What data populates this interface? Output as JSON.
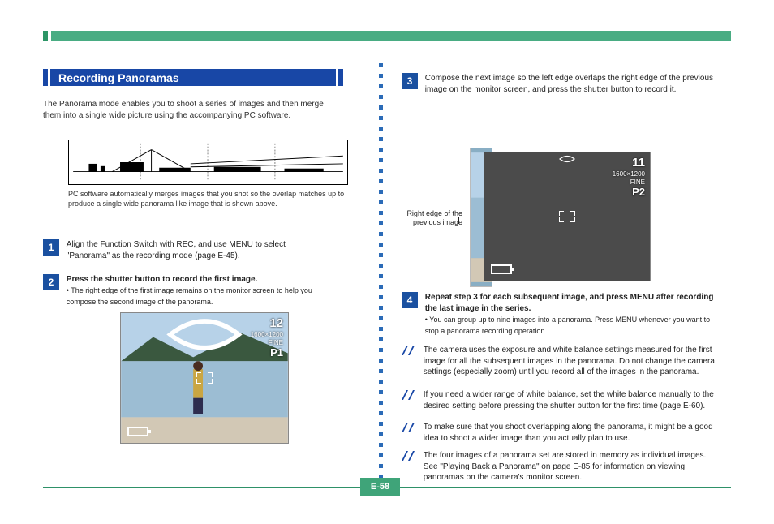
{
  "header": {
    "spacer": " "
  },
  "section": {
    "title": "Recording Panoramas",
    "intro": "The Panorama mode enables you to shoot a series of images and then merge them into a single wide picture using the accompanying PC software."
  },
  "pano_illustration": {
    "caption": "PC software automatically merges images that you shot so the overlap matches up to produce a single wide panorama like image that is shown above."
  },
  "steps": [
    {
      "num": "1",
      "html": "Align the Function Switch with REC, and use MENU to select \"Panorama\" as the recording mode (page E-45)."
    },
    {
      "num": "2",
      "html": "Press the shutter button to record the first image.",
      "note": "The right edge of the first image remains on the monitor screen to help you compose the second image of the panorama."
    },
    {
      "num": "3",
      "html": "Compose the next image so the left edge overlaps the right edge of the previous image on the monitor screen, and press the shutter button to record it."
    },
    {
      "num": "4",
      "html": "Repeat step 3 for each subsequent image, and press MENU after recording the last image in the series.",
      "sub": "You can group up to nine images into a panorama. Press MENU whenever you want to stop a panorama recording operation."
    }
  ],
  "preview1": {
    "count": "12",
    "res": "1600×1200",
    "quality": "FINE",
    "pnum": "P1"
  },
  "preview2": {
    "count": "11",
    "res": "1600×1200",
    "quality": "FINE",
    "pnum": "P2",
    "leader_label": "Right edge of the previous image"
  },
  "right_column": {
    "lead": "Compose the next image so the left edge overlaps the right edge of the previous image on the monitor screen, and press the shutter button to record it."
  },
  "notes": [
    "The camera uses the exposure and white balance settings measured for the first image for all the subsequent images in the panorama. Do not change the camera settings (especially zoom) until you record all of the images in the panorama.",
    "If you need a wider range of white balance, set the white balance manually to the desired setting before pressing the shutter button for the first time (page E-60).",
    "To make sure that you shoot overlapping along the panorama, it might be a good idea to shoot a wider image than you actually plan to use.",
    "The four images of a panorama set are stored in memory as individual images. See \"Playing Back a Panorama\" on page E-85 for information on viewing panoramas on the camera's monitor screen."
  ],
  "footer": {
    "page_number": "E-58"
  }
}
